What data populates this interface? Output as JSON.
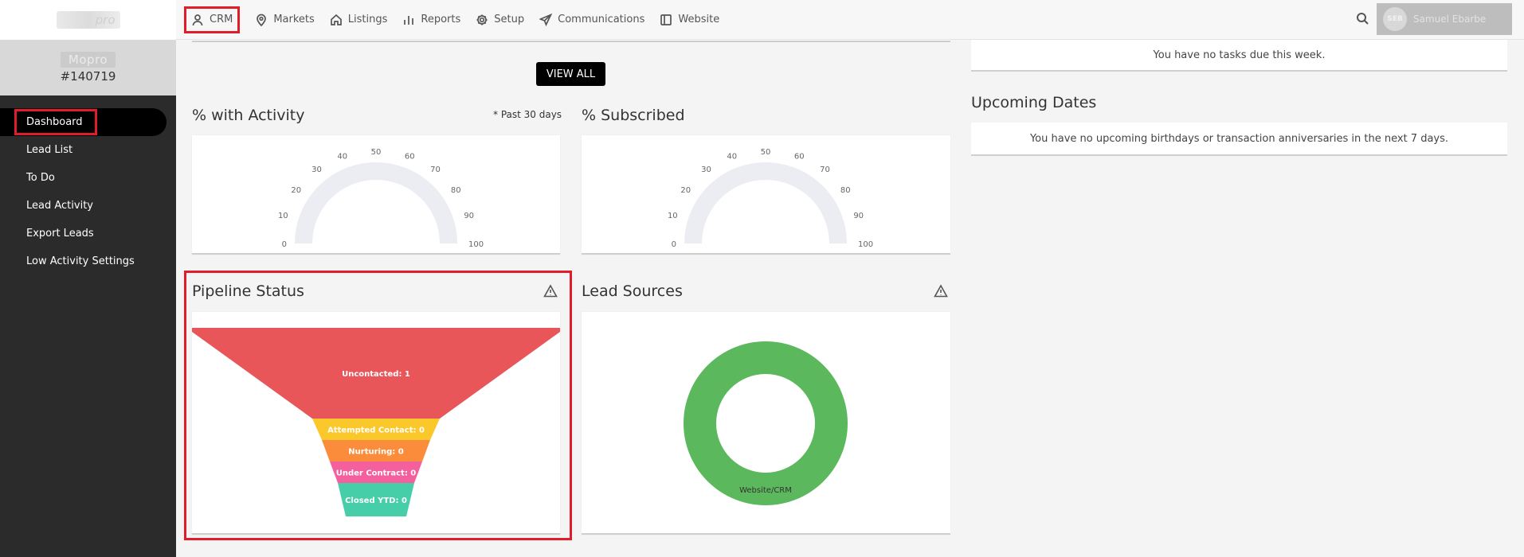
{
  "sidebar": {
    "logo_text": "pro",
    "account_name": "Mopro",
    "account_id": "#140719",
    "items": [
      {
        "label": "Dashboard"
      },
      {
        "label": "Lead List"
      },
      {
        "label": "To Do"
      },
      {
        "label": "Lead Activity"
      },
      {
        "label": "Export Leads"
      },
      {
        "label": "Low Activity Settings"
      }
    ]
  },
  "topbar": {
    "nav": [
      {
        "label": "CRM",
        "icon": "person-icon"
      },
      {
        "label": "Markets",
        "icon": "map-pin-icon"
      },
      {
        "label": "Listings",
        "icon": "home-icon"
      },
      {
        "label": "Reports",
        "icon": "bar-chart-icon"
      },
      {
        "label": "Setup",
        "icon": "gear-icon"
      },
      {
        "label": "Communications",
        "icon": "send-icon"
      },
      {
        "label": "Website",
        "icon": "layout-icon"
      }
    ],
    "user": {
      "initials": "SEB",
      "name": "Samuel Ebarbe"
    }
  },
  "main": {
    "view_all_label": "VIEW ALL",
    "activity": {
      "title": "% with Activity",
      "note": "* Past 30 days"
    },
    "subscribed": {
      "title": "% Subscribed"
    },
    "gauge_ticks": [
      "0",
      "10",
      "20",
      "30",
      "40",
      "50",
      "60",
      "70",
      "80",
      "90",
      "100"
    ],
    "pipeline": {
      "title": "Pipeline Status"
    },
    "lead_sources": {
      "title": "Lead Sources"
    },
    "tasks_message": "You have no tasks due this week.",
    "upcoming": {
      "title": "Upcoming Dates",
      "message": "You have no upcoming birthdays or transaction anniversaries in the next 7 days."
    }
  },
  "chart_data": [
    {
      "type": "gauge",
      "title": "% with Activity",
      "value": 0,
      "ylim": [
        0,
        100
      ]
    },
    {
      "type": "gauge",
      "title": "% Subscribed",
      "value": 0,
      "ylim": [
        0,
        100
      ]
    },
    {
      "type": "funnel",
      "title": "Pipeline Status",
      "categories": [
        "Uncontacted",
        "Attempted Contact",
        "Nurturing",
        "Under Contract",
        "Closed YTD"
      ],
      "values": [
        1,
        0,
        0,
        0,
        0
      ],
      "labels": [
        "Uncontacted: 1",
        "Attempted Contact: 0",
        "Nurturing: 0",
        "Under Contract: 0",
        "Closed YTD: 0"
      ],
      "colors": [
        "#e9565a",
        "#fbc82c",
        "#fb8c3c",
        "#f3609d",
        "#45cea8"
      ]
    },
    {
      "type": "pie",
      "title": "Lead Sources",
      "categories": [
        "Website/CRM"
      ],
      "values": [
        1
      ],
      "colors": [
        "#5cb85c"
      ]
    }
  ]
}
